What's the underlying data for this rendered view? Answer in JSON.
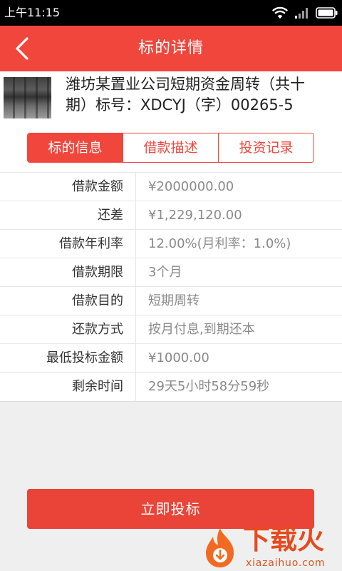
{
  "status_bar": {
    "time": "上午11:15",
    "icons": {
      "wifi": "wifi-icon",
      "signal": "signal-icon",
      "battery": "battery-icon"
    }
  },
  "header": {
    "title": "标的详情",
    "back_icon": "back-chevron-icon"
  },
  "project": {
    "title": "潍坊某置业公司短期资金周转（共十期）标号：XDCYJ（字）00265-5"
  },
  "tabs": [
    {
      "label": "标的信息",
      "selected": true
    },
    {
      "label": "借款描述",
      "selected": false
    },
    {
      "label": "投资记录",
      "selected": false
    }
  ],
  "details": [
    {
      "label": "借款金额",
      "value": "¥2000000.00"
    },
    {
      "label": "还差",
      "value": "¥1,229,120.00"
    },
    {
      "label": "借款年利率",
      "value": "12.00%(月利率：1.0%)"
    },
    {
      "label": "借款期限",
      "value": "3个月"
    },
    {
      "label": "借款目的",
      "value": "短期周转"
    },
    {
      "label": "还款方式",
      "value": "按月付息,到期还本"
    },
    {
      "label": "最低投标金额",
      "value": "¥1000.00"
    },
    {
      "label": "剩余时间",
      "value": "29天5小时58分59秒"
    }
  ],
  "action": {
    "invest_label": "立即投标"
  },
  "watermark": {
    "brand": "下载火",
    "site": "xiazaihuo.com",
    "logo_icon": "flame-logo-icon"
  },
  "colors": {
    "accent": "#f1463c",
    "button": "#ea4438",
    "status_bar": "#000000",
    "page_background": "#efefef",
    "label_text": "#333333",
    "value_text": "#8a8a8a"
  }
}
